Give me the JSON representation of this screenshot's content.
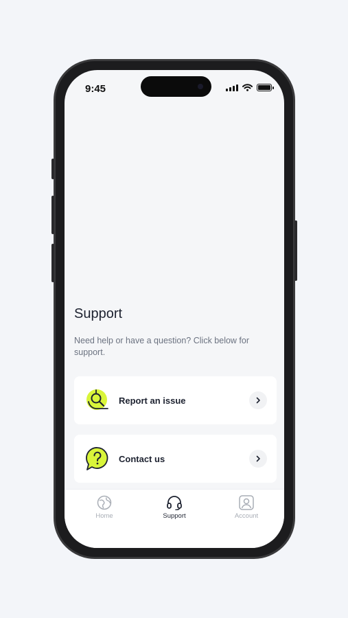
{
  "status_bar": {
    "time": "9:45"
  },
  "page": {
    "title": "Support",
    "subtitle": "Need help or have a question? Click below for support."
  },
  "cards": [
    {
      "label": "Report an issue",
      "icon": "search-issue-icon"
    },
    {
      "label": "Contact us",
      "icon": "question-bubble-icon"
    }
  ],
  "tabs": [
    {
      "label": "Home",
      "icon": "globe-icon",
      "active": false
    },
    {
      "label": "Support",
      "icon": "headset-icon",
      "active": true
    },
    {
      "label": "Account",
      "icon": "user-icon",
      "active": false
    }
  ],
  "colors": {
    "accent": "#d9f53a",
    "text": "#1d2230",
    "muted": "#6b7280",
    "inactive_tab": "#a8adb5"
  }
}
